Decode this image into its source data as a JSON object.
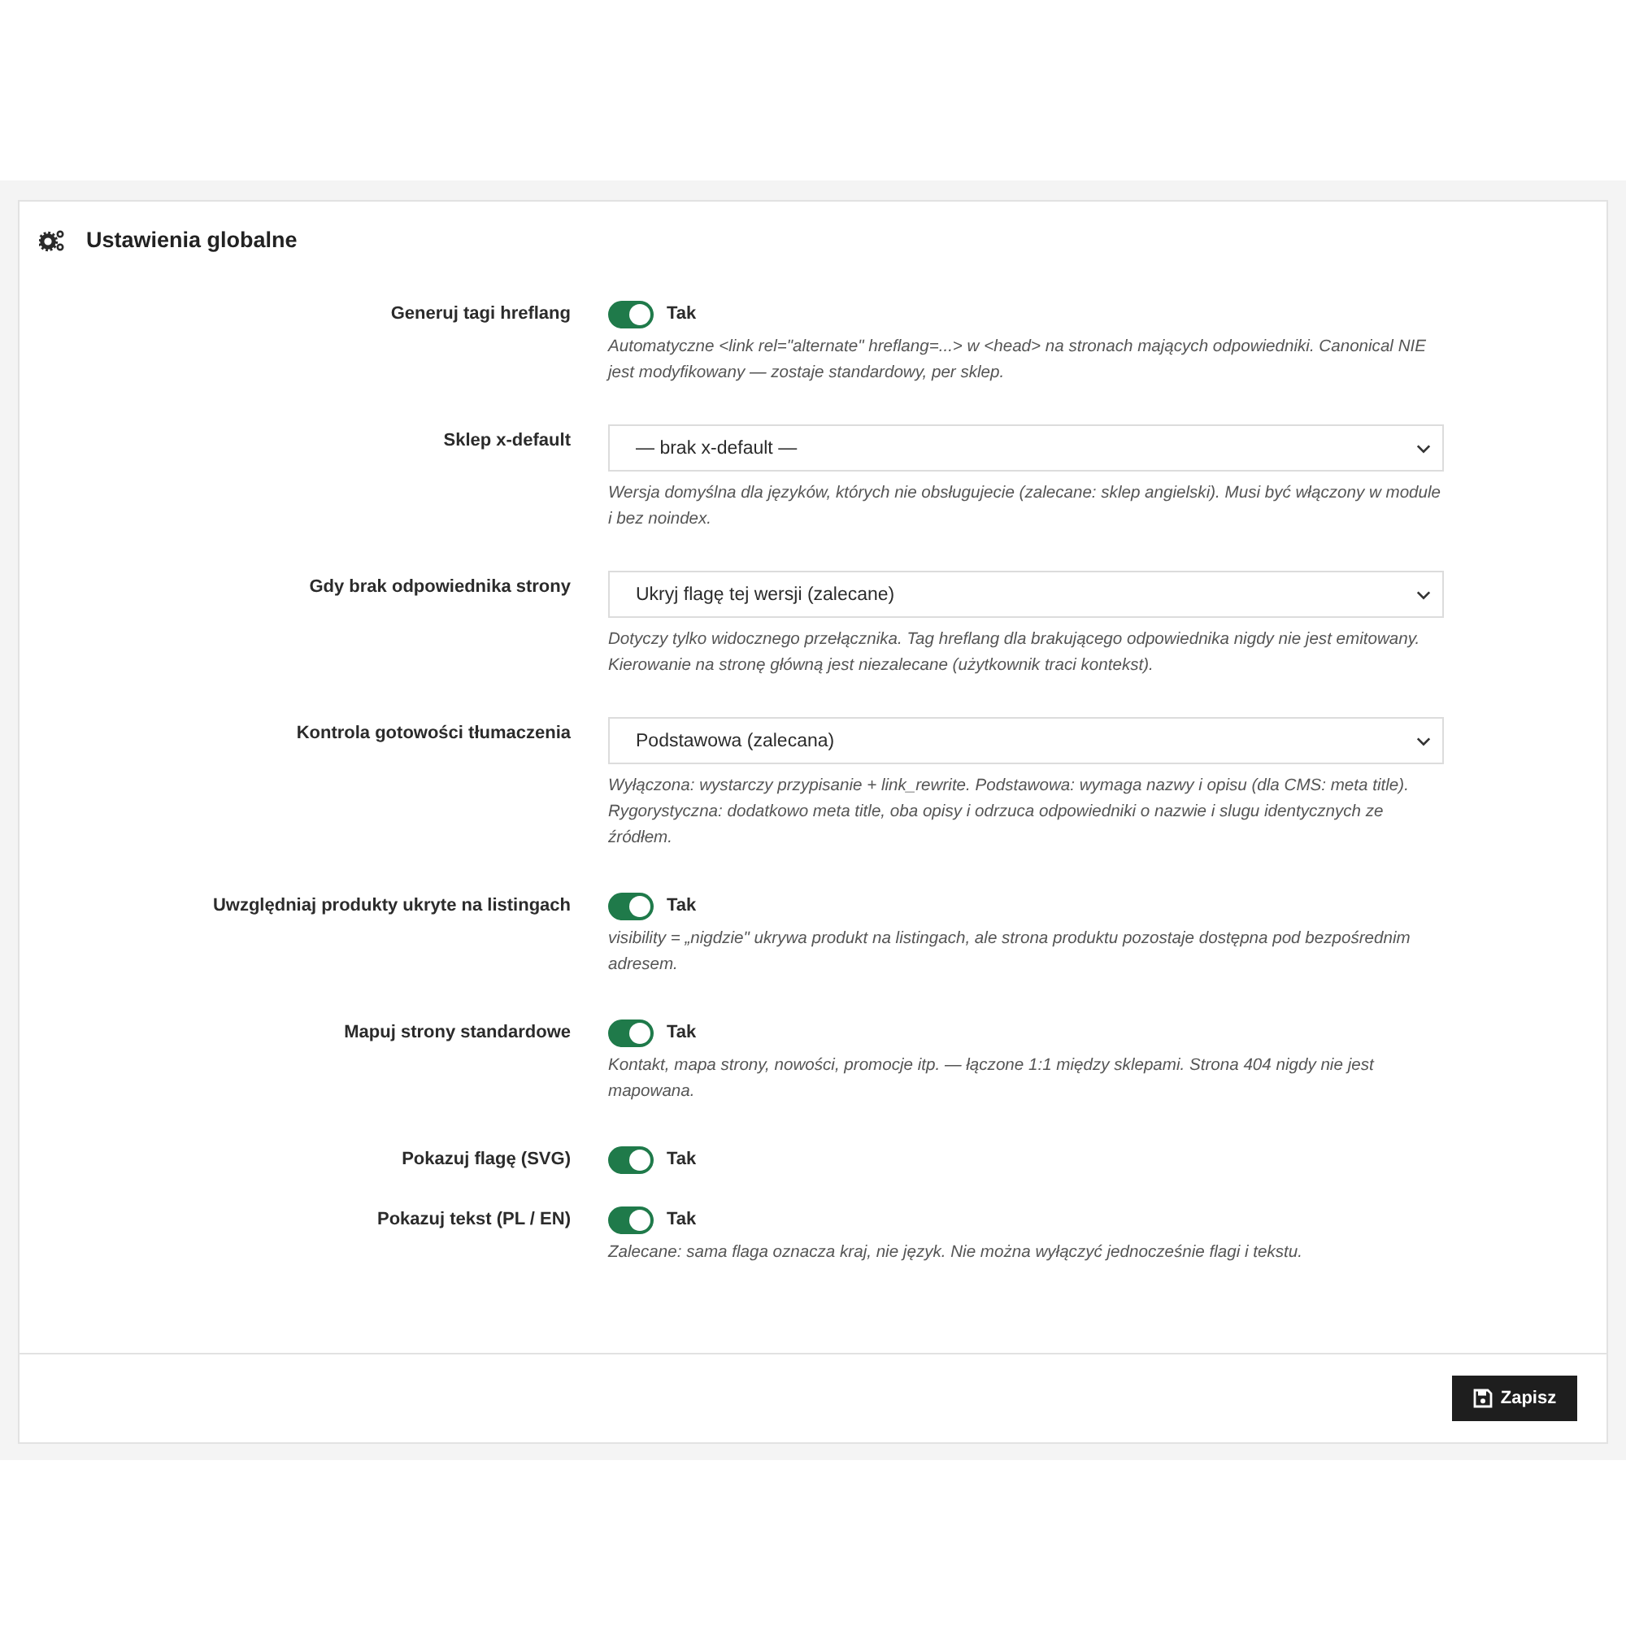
{
  "panel": {
    "title": "Ustawienia globalne"
  },
  "fields": [
    {
      "kind": "toggle",
      "label": "Generuj tagi hreflang",
      "on": true,
      "state_text": "Tak",
      "help": "Automatyczne <link rel=\"alternate\" hreflang=...> w <head> na stronach mających odpowiedniki. Canonical NIE jest modyfikowany — zostaje standardowy, per sklep."
    },
    {
      "kind": "select",
      "label": "Sklep x-default",
      "value": "— brak x-default —",
      "help": "Wersja domyślna dla języków, których nie obsługujecie (zalecane: sklep angielski). Musi być włączony w module i bez noindex."
    },
    {
      "kind": "select",
      "label": "Gdy brak odpowiednika strony",
      "value": "Ukryj flagę tej wersji (zalecane)",
      "help": "Dotyczy tylko widocznego przełącznika. Tag hreflang dla brakującego odpowiednika nigdy nie jest emitowany. Kierowanie na stronę główną jest niezalecane (użytkownik traci kontekst)."
    },
    {
      "kind": "select",
      "label": "Kontrola gotowości tłumaczenia",
      "value": "Podstawowa (zalecana)",
      "help": "Wyłączona: wystarczy przypisanie + link_rewrite. Podstawowa: wymaga nazwy i opisu (dla CMS: meta title). Rygorystyczna: dodatkowo meta title, oba opisy i odrzuca odpowiedniki o nazwie i slugu identycznych ze źródłem."
    },
    {
      "kind": "toggle",
      "label": "Uwzględniaj produkty ukryte na listingach",
      "on": true,
      "state_text": "Tak",
      "help": "visibility = „nigdzie\" ukrywa produkt na listingach, ale strona produktu pozostaje dostępna pod bezpośrednim adresem."
    },
    {
      "kind": "toggle",
      "label": "Mapuj strony standardowe",
      "on": true,
      "state_text": "Tak",
      "help": "Kontakt, mapa strony, nowości, promocje itp. — łączone 1:1 między sklepami. Strona 404 nigdy nie jest mapowana."
    },
    {
      "kind": "toggle",
      "label": "Pokazuj flagę (SVG)",
      "on": true,
      "state_text": "Tak"
    },
    {
      "kind": "toggle",
      "label": "Pokazuj tekst (PL / EN)",
      "on": true,
      "state_text": "Tak",
      "help": "Zalecane: sama flaga oznacza kraj, nie język. Nie można wyłączyć jednocześnie flagi i tekstu."
    }
  ],
  "footer": {
    "save_button": "Zapisz"
  }
}
